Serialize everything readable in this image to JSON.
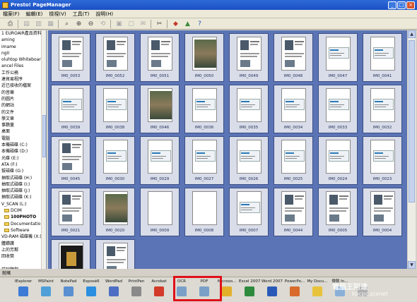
{
  "window": {
    "title": "Presto! PageManager"
  },
  "menu": [
    "檔案(F)",
    "編輯(E)",
    "檢視(V)",
    "工具(T)",
    "說明(H)"
  ],
  "toolbar_icons": [
    "scan-icon",
    "print-icon",
    "print-preview-icon",
    "save-icon",
    "search-icon",
    "zoom-in-icon",
    "zoom-out-icon",
    "rotate-icon",
    "stack-icon",
    "unstack-icon",
    "send-icon",
    "tools-icon",
    "convert-icon",
    "acquire-icon",
    "help-icon"
  ],
  "tree": [
    {
      "label": "1 EUROAIR產品資料",
      "indent": false
    },
    {
      "label": "aming",
      "indent": false
    },
    {
      "label": "imame",
      "indent": false
    },
    {
      "label": "ngII",
      "indent": false
    },
    {
      "label": "oluhtop Whiteboard",
      "indent": false
    },
    {
      "label": "ancel Files",
      "indent": false
    },
    {
      "label": "工作公務",
      "indent": false
    },
    {
      "label": "達貿易程序",
      "indent": false
    },
    {
      "label": "近已接收的檔案",
      "indent": false
    },
    {
      "label": "的音樂",
      "indent": false
    },
    {
      "label": "的圖片",
      "indent": false
    },
    {
      "label": "的網站",
      "indent": false
    },
    {
      "label": "的文件",
      "indent": false
    },
    {
      "label": "學文章",
      "indent": false
    },
    {
      "label": "事蹟量",
      "indent": false
    },
    {
      "label": "桌面",
      "indent": false
    },
    {
      "label": "電腦",
      "indent": false
    },
    {
      "label": "本機磁碟 (C:)",
      "indent": false
    },
    {
      "label": "本機磁碟 (D:)",
      "indent": false
    },
    {
      "label": "光碟 (E:)",
      "indent": false
    },
    {
      "label": "ATA (F:)",
      "indent": false
    },
    {
      "label": "拔磁碟 (G:)",
      "indent": false
    },
    {
      "label": "抽取式磁碟 (H:)",
      "indent": false
    },
    {
      "label": "抽取式磁碟 (I:)",
      "indent": false
    },
    {
      "label": "抽取式磁碟 (J:)",
      "indent": false
    },
    {
      "label": "抽取式磁碟 (K:)",
      "indent": false
    },
    {
      "label": "V_SCAN (L:)",
      "indent": false
    },
    {
      "label": "DCIM",
      "indent": true
    },
    {
      "label": "100PHOTO",
      "indent": true,
      "bold": true
    },
    {
      "label": "Documentation",
      "indent": true
    },
    {
      "label": "Software",
      "indent": true
    },
    {
      "label": "VD-RAM 磁碟機 (X:)",
      "indent": false
    },
    {
      "label": "體鑽讚",
      "indent": false
    },
    {
      "label": "上的芳鄰",
      "indent": false
    },
    {
      "label": "回收筒",
      "indent": false
    },
    {
      "label": "",
      "indent": false
    },
    {
      "label": "諾阿鑒劃",
      "indent": false
    },
    {
      "label": "j",
      "indent": false
    },
    {
      "label": "rdata",
      "indent": false
    }
  ],
  "pages": [
    {
      "name": "IM0_0053",
      "style": "doc"
    },
    {
      "name": "IM0_0052",
      "style": "doc"
    },
    {
      "name": "IM0_0051",
      "style": "doc"
    },
    {
      "name": "IM0_0050",
      "style": "photo"
    },
    {
      "name": "IM0_0049",
      "style": "doc"
    },
    {
      "name": "IM0_0048",
      "style": "doc"
    },
    {
      "name": "IM0_0047",
      "style": "card"
    },
    {
      "name": "IM0_0041",
      "style": "card"
    },
    {
      "name": "IM0_0040",
      "style": "card"
    },
    {
      "name": "IM0_0039",
      "style": "card"
    },
    {
      "name": "IM0_0038",
      "style": "card"
    },
    {
      "name": "IM0_0046",
      "style": "photo"
    },
    {
      "name": "IM0_0036",
      "style": "card"
    },
    {
      "name": "IM0_0035",
      "style": "card"
    },
    {
      "name": "IM0_0034",
      "style": "card"
    },
    {
      "name": "IM0_0033",
      "style": "card"
    },
    {
      "name": "IM0_0032",
      "style": "card"
    },
    {
      "name": "IM0_0031",
      "style": "card"
    },
    {
      "name": "IM0_0045",
      "style": "doc"
    },
    {
      "name": "IM0_0030",
      "style": "card"
    },
    {
      "name": "IM0_0029",
      "style": "card"
    },
    {
      "name": "IM0_0027",
      "style": "card"
    },
    {
      "name": "IM0_0026",
      "style": "card"
    },
    {
      "name": "IM0_0025",
      "style": "card"
    },
    {
      "name": "IM0_0024",
      "style": "card"
    },
    {
      "name": "IM0_0023",
      "style": "card"
    },
    {
      "name": "IM0_0022",
      "style": "card"
    },
    {
      "name": "IM0_0021",
      "style": "doc"
    },
    {
      "name": "IM0_0020",
      "style": "photo"
    },
    {
      "name": "IM0_0009",
      "style": "blank"
    },
    {
      "name": "IM0_0008",
      "style": "blank"
    },
    {
      "name": "IM0_0007",
      "style": "card"
    },
    {
      "name": "IM0_0044",
      "style": "doc"
    },
    {
      "name": "IM0_0005",
      "style": "doc"
    },
    {
      "name": "IM0_0004",
      "style": "doc"
    },
    {
      "name": "IM0_0043",
      "style": "doc"
    },
    {
      "name": "",
      "style": "dark"
    },
    {
      "name": "",
      "style": "doc"
    }
  ],
  "bottom_label": "就緒",
  "dock_apps": [
    {
      "name": "IExplorer",
      "color": "#3d7bd6"
    },
    {
      "name": "MSPaint",
      "color": "#4fa0d8"
    },
    {
      "name": "NotePad",
      "color": "#5a8fd0"
    },
    {
      "name": "Exposé6",
      "color": "#2a8fe0"
    },
    {
      "name": "WordPad",
      "color": "#4e6fc4"
    },
    {
      "name": "PrintPen",
      "color": "#8a8a8a"
    },
    {
      "name": "Acrobat",
      "color": "#d23a2a"
    },
    {
      "name": "OCR",
      "color": "#7aa0c8"
    },
    {
      "name": "PDF",
      "color": "#7aa0c8"
    },
    {
      "name": "Microso...",
      "color": "#e3b02a"
    },
    {
      "name": "Excel 2007",
      "color": "#2e8b3e"
    },
    {
      "name": "Word 2007",
      "color": "#2a5ab8"
    },
    {
      "name": "PowerPo...",
      "color": "#d86a2a"
    },
    {
      "name": "My Docu...",
      "color": "#e8c23a"
    },
    {
      "name": "微軟 In...",
      "color": "#8ab0d8"
    },
    {
      "name": "",
      "color": "#b0b0b0"
    }
  ],
  "watermark": {
    "line1": "電腦王阿達",
    "line2": "kocpc.pixnet"
  }
}
